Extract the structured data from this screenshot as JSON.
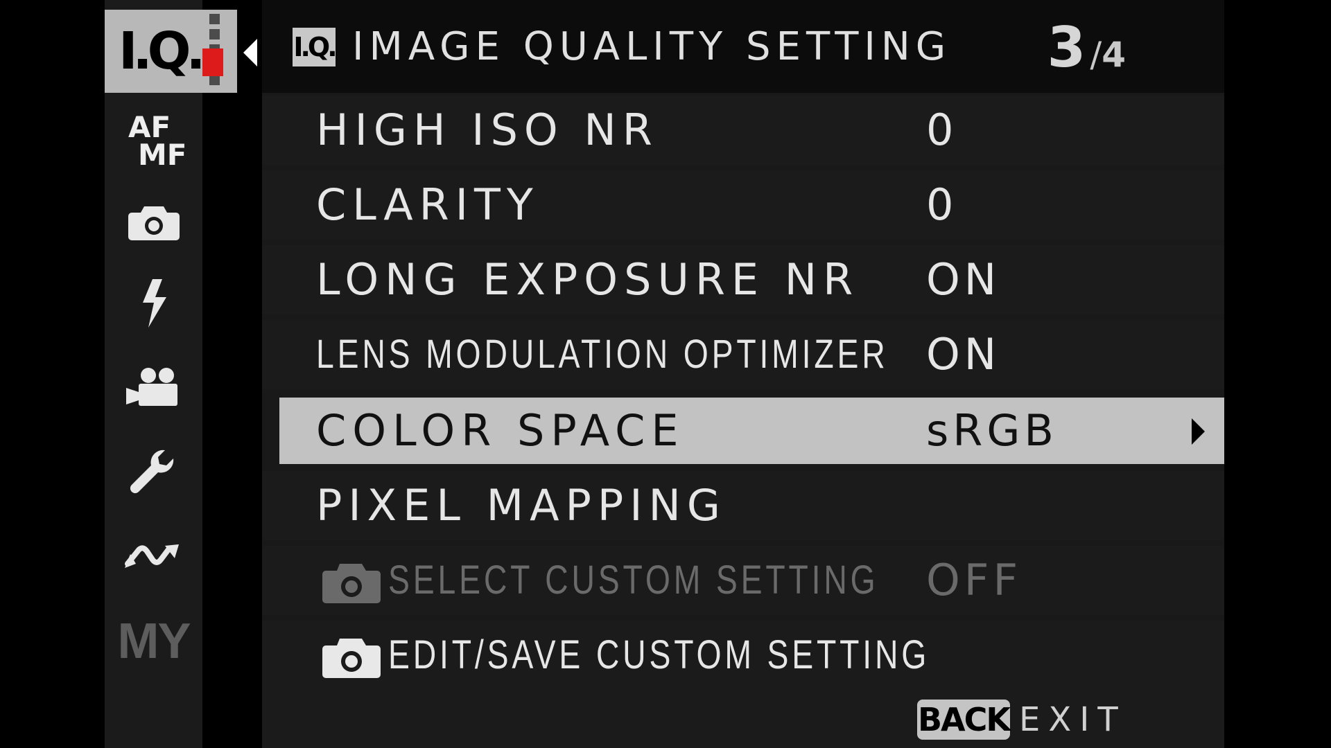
{
  "sidebar": {
    "active_tab": {
      "label": "I.Q.",
      "icon": "iq-image-quality-icon"
    },
    "categories": [
      {
        "id": "af-mf",
        "label_top": "AF",
        "label_bottom": "MF",
        "icon": "af-mf-icon"
      },
      {
        "id": "shooting",
        "icon": "camera-icon"
      },
      {
        "id": "flash",
        "icon": "flash-icon"
      },
      {
        "id": "movie",
        "icon": "movie-camera-icon"
      },
      {
        "id": "setup",
        "icon": "wrench-icon"
      },
      {
        "id": "connection",
        "icon": "connection-wave-icon"
      },
      {
        "id": "my-menu",
        "label": "MY",
        "icon": "my-menu-icon"
      }
    ]
  },
  "header": {
    "badge": "I.Q.",
    "title": "IMAGE QUALITY SETTING",
    "page_current": "3",
    "page_separator": "/",
    "page_total": "4"
  },
  "menu": {
    "items": [
      {
        "label": "HIGH ISO NR",
        "value": "0"
      },
      {
        "label": "CLARITY",
        "value": "0"
      },
      {
        "label": "LONG EXPOSURE NR",
        "value": "ON"
      },
      {
        "label": "LENS MODULATION OPTIMIZER",
        "value": "ON"
      },
      {
        "label": "COLOR SPACE",
        "value": "sRGB",
        "selected": true
      },
      {
        "label": "PIXEL MAPPING",
        "value": ""
      },
      {
        "label": "SELECT CUSTOM SETTING",
        "value": "OFF",
        "disabled": true,
        "icon": "camera-icon"
      },
      {
        "label": "EDIT/SAVE CUSTOM SETTING",
        "value": "",
        "icon": "camera-icon"
      }
    ]
  },
  "footer": {
    "back_key": "BACK",
    "exit_label": "EXIT"
  },
  "colors": {
    "selection_red": "#cc1212",
    "iq_red": "#dd1b1b",
    "selected_row_bg": "#c2c2c2"
  }
}
